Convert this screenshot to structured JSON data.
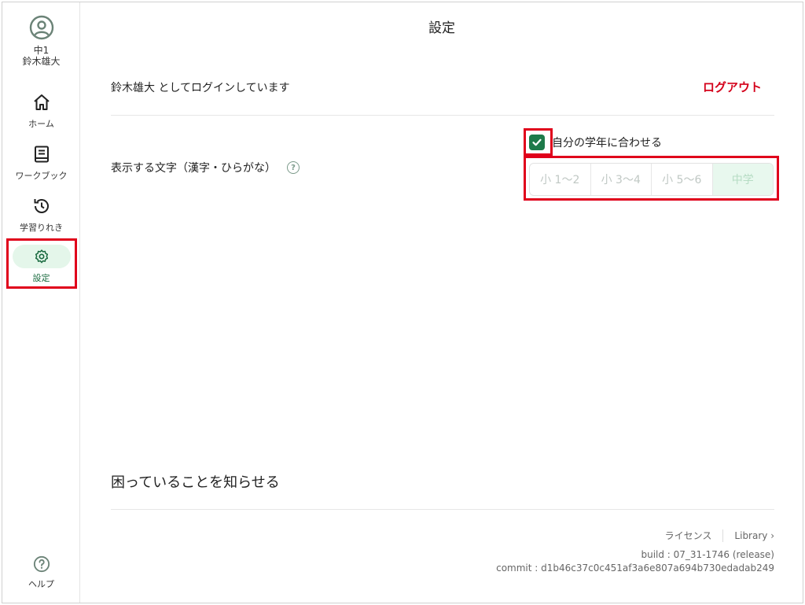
{
  "sidebar": {
    "profile": {
      "grade": "中1",
      "name": "鈴木雄大"
    },
    "items": [
      {
        "label": "ホーム",
        "icon": "home-icon"
      },
      {
        "label": "ワークブック",
        "icon": "book-icon"
      },
      {
        "label": "学習りれき",
        "icon": "history-icon"
      },
      {
        "label": "設定",
        "icon": "gear-icon",
        "active": true
      }
    ],
    "help": {
      "label": "ヘルプ",
      "icon": "help-circle-icon"
    }
  },
  "main": {
    "title": "設定",
    "login_text": "鈴木雄大 としてログインしています",
    "logout_label": "ログアウト",
    "kanji_setting_label": "表示する文字（漢字・ひらがな）",
    "help_icon_glyph": "?",
    "match_grade": {
      "label": "自分の学年に合わせる",
      "checked": true
    },
    "grade_options": [
      "小 1〜2",
      "小 3〜4",
      "小 5〜6",
      "中学"
    ],
    "selected_grade": "中学",
    "trouble_label": "困っていることを知らせる",
    "footer": {
      "license_label": "ライセンス",
      "library_label": "Library ›",
      "build": "build : 07_31-1746 (release)",
      "commit": "commit : d1b46c37c0c451af3a6e807a694b730edadab249"
    }
  },
  "colors": {
    "accent_green": "#1e7a4a",
    "logout_red": "#d4001a",
    "highlight_red": "#e0001b",
    "active_pill": "#e4f6ea"
  }
}
